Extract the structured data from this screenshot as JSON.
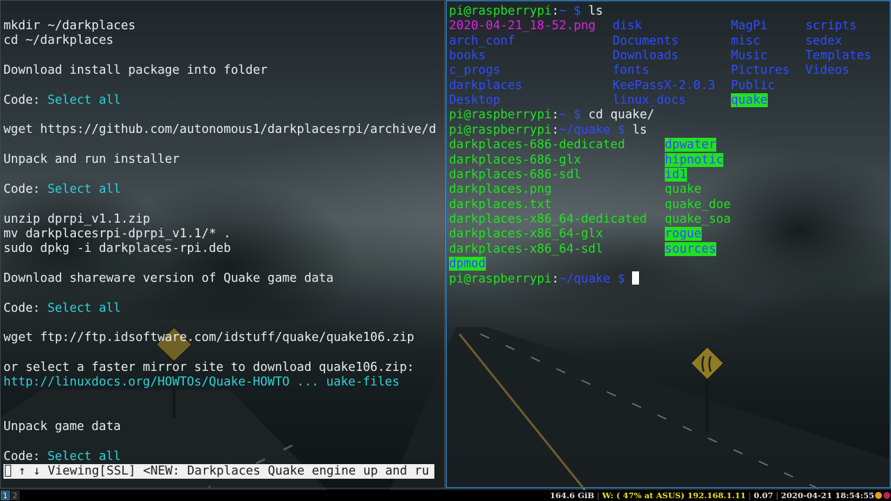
{
  "left_pane": {
    "lines": [
      "mkdir ~/darkplaces",
      "cd ~/darkplaces",
      "",
      "Download install package into folder",
      "",
      [
        "Code: ",
        "Select all"
      ],
      "",
      "wget https://github.com/autonomous1/darkplacesrpi/archive/d",
      "",
      "Unpack and run installer",
      "",
      [
        "Code: ",
        "Select all"
      ],
      "",
      "unzip dprpi_v1.1.zip",
      "mv darkplacesrpi-dprpi_v1.1/* .",
      "sudo dpkg -i darkplaces-rpi.deb",
      "",
      "Download shareware version of Quake game data",
      "",
      [
        "Code: ",
        "Select all"
      ],
      "",
      "wget ftp://ftp.idsoftware.com/idstuff/quake/quake106.zip",
      "",
      "or select a faster mirror site to download quake106.zip:",
      "http://linuxdocs.org/HOWTOs/Quake-HOWTO ... uake-files",
      "",
      "",
      "Unpack game data",
      "",
      [
        "Code: ",
        "Select all"
      ]
    ],
    "code_label": "Code: ",
    "select_all": "Select all",
    "status_bar": " ↑ ↓ Viewing[SSL] <NEW: Darkplaces Quake engine up and ru"
  },
  "right_pane": {
    "prompt_user": "pi@raspberrypi",
    "prompt_home": "~",
    "prompt_quake": "~/quake",
    "cmd_ls": "ls",
    "cmd_cd": "cd quake/",
    "home_listing": [
      [
        "2020-04-21_18-52.png",
        "disk",
        "MagPi",
        "scripts"
      ],
      [
        "arch_conf",
        "Documents",
        "misc",
        "sedex"
      ],
      [
        "books",
        "Downloads",
        "Music",
        "Templates"
      ],
      [
        "c_progs",
        "fonts",
        "Pictures",
        "Videos"
      ],
      [
        "darkplaces",
        "KeePassX-2.0.3",
        "Public",
        ""
      ],
      [
        "Desktop",
        "linux_docs",
        "quake",
        ""
      ]
    ],
    "quake_listing": [
      [
        "darkplaces-686-dedicated",
        "dpwater"
      ],
      [
        "darkplaces-686-glx",
        "hipnotic"
      ],
      [
        "darkplaces-686-sdl",
        "id1"
      ],
      [
        "darkplaces.png",
        "quake"
      ],
      [
        "darkplaces.txt",
        "quake_doe"
      ],
      [
        "darkplaces-x86_64-dedicated",
        "quake_soa"
      ],
      [
        "darkplaces-x86_64-glx",
        "rogue"
      ],
      [
        "darkplaces-x86_64-sdl",
        "sources"
      ],
      [
        "dpmod",
        ""
      ]
    ]
  },
  "bar": {
    "workspaces": [
      "1",
      "2"
    ],
    "disk": "164.6 GiB",
    "wifi": "W: ( 47% at ASUS) 192.168.1.11",
    "load": "0.07",
    "datetime": "2020-04-21 18:54:55"
  },
  "colors": {
    "prompt_green": "#22e022",
    "dir_blue": "#2f4cff",
    "png_magenta": "#e020e0",
    "link_cyan": "#2fd0d8",
    "active_border": "#2c6c9e"
  }
}
